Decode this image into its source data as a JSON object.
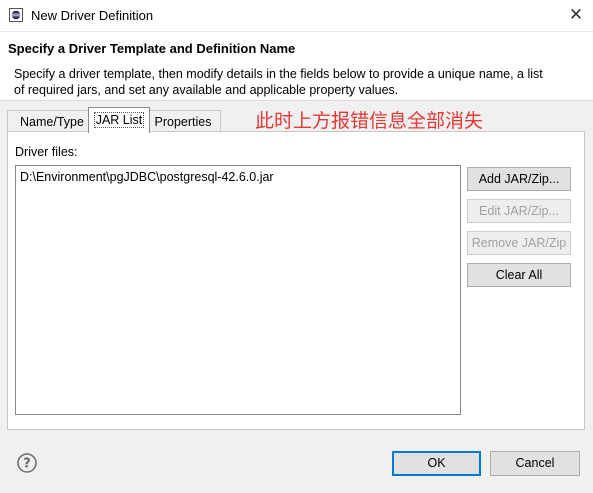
{
  "window": {
    "title": "New Driver Definition",
    "close_glyph": "✕"
  },
  "header": {
    "title": "Specify a Driver Template and Definition Name",
    "description": "Specify a driver template, then modify details in the fields below to provide a unique name, a list of required jars, and set any available and applicable property values."
  },
  "tabs": [
    {
      "label": "Name/Type",
      "selected": false
    },
    {
      "label": "JAR List",
      "selected": true
    },
    {
      "label": "Properties",
      "selected": false
    }
  ],
  "annotation_text": "此时上方报错信息全部消失",
  "annotation_color": "#e53935",
  "jar_panel": {
    "label": "Driver files:",
    "items": [
      "D:\\Environment\\pgJDBC\\postgresql-42.6.0.jar"
    ]
  },
  "buttons": {
    "add": {
      "label": "Add JAR/Zip...",
      "enabled": true
    },
    "edit": {
      "label": "Edit JAR/Zip...",
      "enabled": false
    },
    "remove": {
      "label": "Remove JAR/Zip",
      "enabled": false
    },
    "clear": {
      "label": "Clear All",
      "enabled": true
    },
    "ok": {
      "label": "OK"
    },
    "cancel": {
      "label": "Cancel"
    }
  },
  "icons": {
    "app": "eclipse-app-icon",
    "help": "help-icon"
  }
}
